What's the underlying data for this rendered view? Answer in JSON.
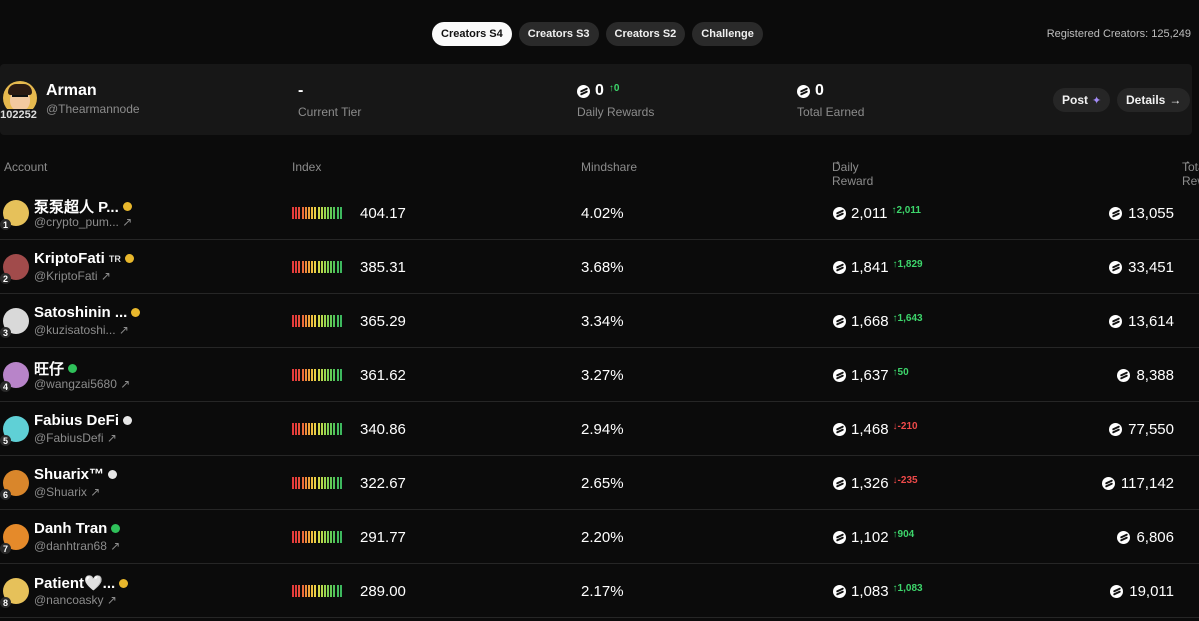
{
  "tabs": [
    "Creators S4",
    "Creators S3",
    "Creators S2",
    "Challenge"
  ],
  "registered_label": "Registered Creators: 125,249",
  "user": {
    "name": "Arman",
    "handle": "@Thearmannode",
    "rank": "102252",
    "tier_value": "-",
    "tier_label": "Current Tier",
    "daily_value": "0",
    "daily_delta": "0",
    "daily_label": "Daily Rewards",
    "total_value": "0",
    "total_label": "Total Earned",
    "post_label": "Post",
    "details_label": "Details"
  },
  "columns": {
    "account": "Account",
    "index": "Index",
    "mindshare": "Mindshare",
    "daily": "Daily Reward",
    "total": "Total Reward"
  },
  "rows": [
    {
      "rank": "1",
      "name": "泵泵超人 P...",
      "tag": "",
      "badge": "gold",
      "handle": "@crypto_pum...",
      "index": "404.17",
      "mindshare": "4.02%",
      "daily": "2,011",
      "delta": "2,011",
      "dir": "up",
      "total": "13,055",
      "avatar": "#e6c15a"
    },
    {
      "rank": "2",
      "name": "KriptoFati",
      "tag": "TR",
      "badge": "gold",
      "handle": "@KriptoFati",
      "index": "385.31",
      "mindshare": "3.68%",
      "daily": "1,841",
      "delta": "1,829",
      "dir": "up",
      "total": "33,451",
      "avatar": "#a14b4b"
    },
    {
      "rank": "3",
      "name": "Satoshinin ...",
      "tag": "",
      "badge": "gold",
      "handle": "@kuzisatoshi...",
      "index": "365.29",
      "mindshare": "3.34%",
      "daily": "1,668",
      "delta": "1,643",
      "dir": "up",
      "total": "13,614",
      "avatar": "#d9d9d9"
    },
    {
      "rank": "4",
      "name": "旺仔",
      "tag": "",
      "badge": "green",
      "handle": "@wangzai5680",
      "index": "361.62",
      "mindshare": "3.27%",
      "daily": "1,637",
      "delta": "50",
      "dir": "up",
      "total": "8,388",
      "avatar": "#b884c9"
    },
    {
      "rank": "5",
      "name": "Fabius DeFi",
      "tag": "",
      "badge": "white",
      "handle": "@FabiusDefi",
      "index": "340.86",
      "mindshare": "2.94%",
      "daily": "1,468",
      "delta": "-210",
      "dir": "down",
      "total": "77,550",
      "avatar": "#5fd0d6"
    },
    {
      "rank": "6",
      "name": "Shuarix™",
      "tag": "",
      "badge": "white",
      "handle": "@Shuarix",
      "index": "322.67",
      "mindshare": "2.65%",
      "daily": "1,326",
      "delta": "-235",
      "dir": "down",
      "total": "117,142",
      "avatar": "#d9862b"
    },
    {
      "rank": "7",
      "name": "Danh Tran",
      "tag": "",
      "badge": "green",
      "handle": "@danhtran68",
      "index": "291.77",
      "mindshare": "2.20%",
      "daily": "1,102",
      "delta": "904",
      "dir": "up",
      "total": "6,806",
      "avatar": "#e58a2a"
    },
    {
      "rank": "8",
      "name": "Patient🤍...",
      "tag": "",
      "badge": "gold",
      "handle": "@nancoasky",
      "index": "289.00",
      "mindshare": "2.17%",
      "daily": "1,083",
      "delta": "1,083",
      "dir": "up",
      "total": "19,011",
      "avatar": "#e6c15a"
    }
  ],
  "colors": {
    "bars": [
      "#e53b3b",
      "#e53b3b",
      "#e8503a",
      "#eb6a3a",
      "#ee8a3b",
      "#f0a43c",
      "#f0bd3f",
      "#e9cf44",
      "#d2d84a",
      "#b8d84c",
      "#9bd54f",
      "#7fd053",
      "#66ca56",
      "#52c459",
      "#45be5c",
      "#3db85e"
    ],
    "up": "#3dd66b",
    "down": "#ef4a4a"
  }
}
